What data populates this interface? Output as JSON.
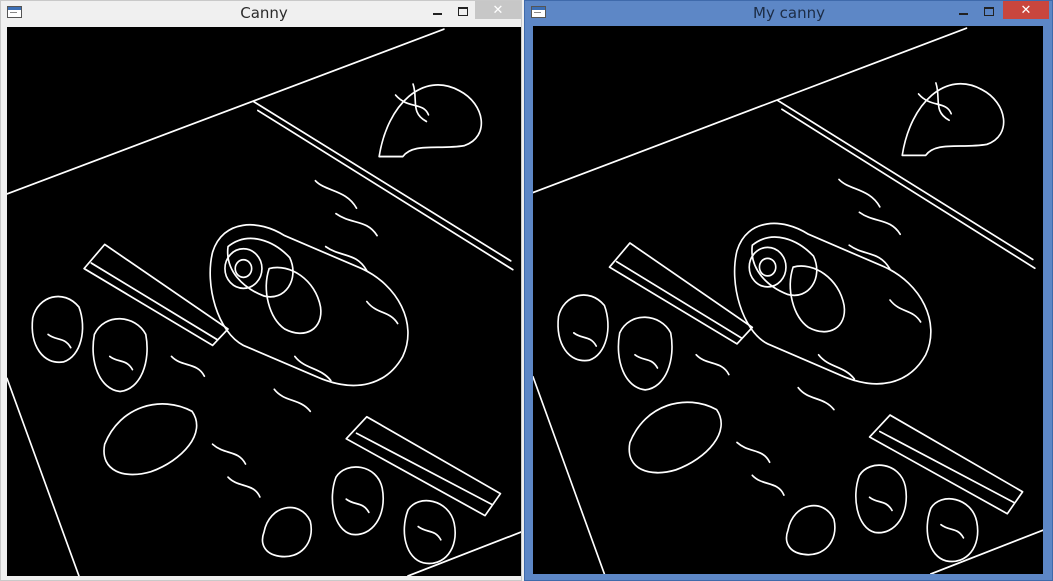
{
  "windows": {
    "left": {
      "title": "Canny"
    },
    "right": {
      "title": "My canny"
    }
  },
  "controls": {
    "close_glyph": "✕"
  },
  "colors": {
    "active_frame": "#5d87c6",
    "close_active": "#c9463d",
    "close_inactive": "#c7c7c7",
    "image_bg": "#000000",
    "edges": "#ffffff"
  }
}
